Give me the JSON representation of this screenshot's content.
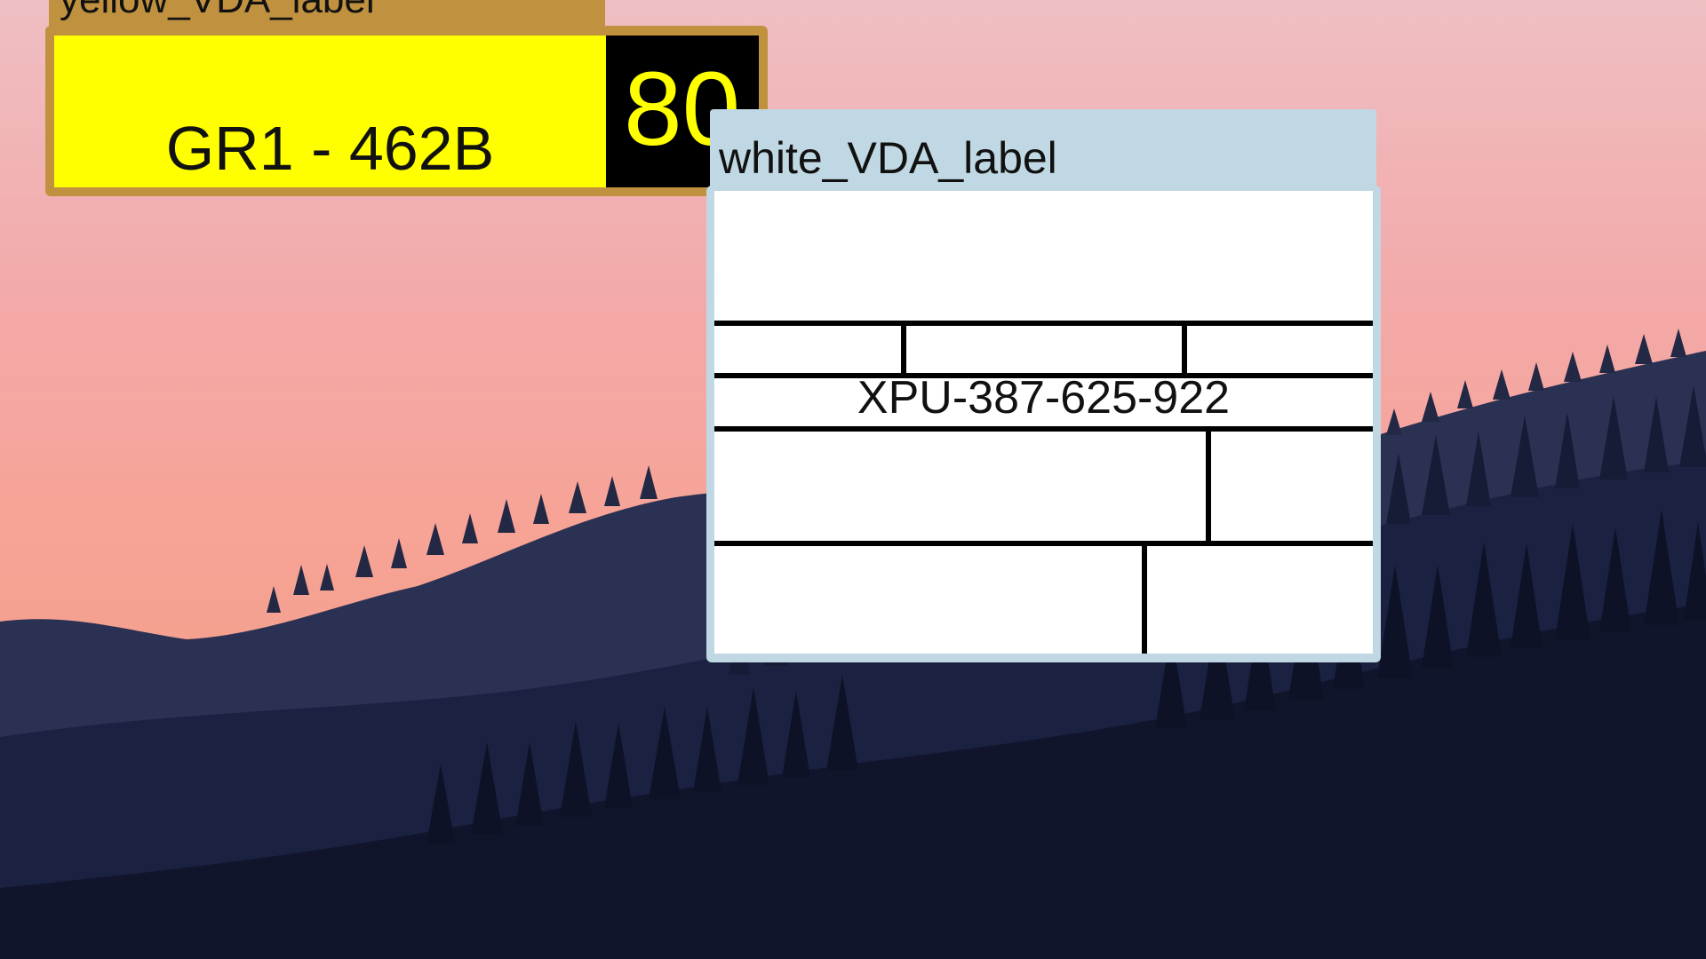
{
  "desktop": {
    "wallpaper": "sunset-mountain-forest",
    "colors": {
      "sky": "#f3aaaa",
      "ridge": "#2b3152",
      "forest": "#121830"
    }
  },
  "yellow_window": {
    "title": "yellow_VDA_label",
    "code": "GR1 - 462B",
    "number": "80",
    "colors": {
      "frame": "#c0913f",
      "panel": "#ffff00",
      "number_bg": "#000000",
      "number_fg": "#ffff00"
    }
  },
  "white_window": {
    "title": "white_VDA_label",
    "code": "XPU-387-625-922",
    "colors": {
      "frame": "#c0d8e3",
      "panel": "#ffffff",
      "grid": "#000000"
    }
  }
}
